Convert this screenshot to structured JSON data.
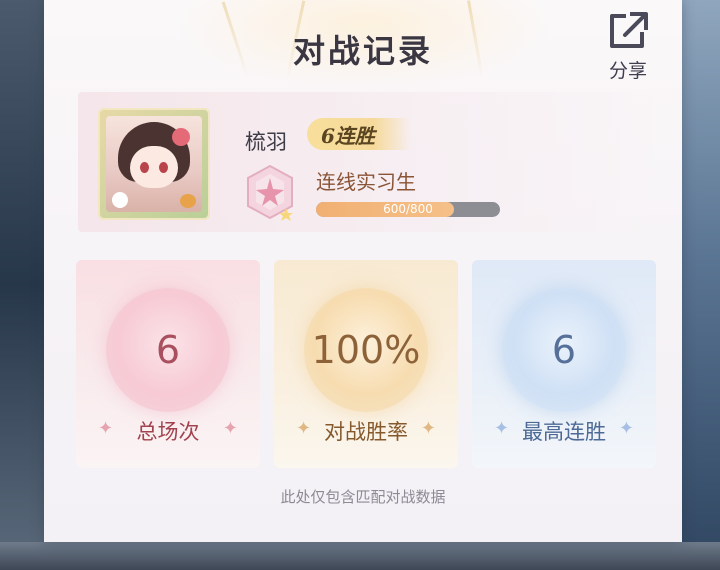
{
  "header": {
    "title": "对战记录",
    "share_label": "分享",
    "share_icon": "share-icon"
  },
  "profile": {
    "username": "梳羽",
    "streak_badge": "6连胜",
    "rank_name": "连线实习生",
    "xp_text": "600/800",
    "xp_current": 600,
    "xp_max": 800,
    "rank_icon": "pink-star-emblem-icon"
  },
  "stats": [
    {
      "value": "6",
      "label": "总场次",
      "theme": "pink"
    },
    {
      "value": "100%",
      "label": "对战胜率",
      "theme": "gold"
    },
    {
      "value": "6",
      "label": "最高连胜",
      "theme": "blue"
    }
  ],
  "footnote": "此处仅包含匹配对战数据",
  "colors": {
    "pink_accent": "#a8505f",
    "gold_accent": "#8d6238",
    "blue_accent": "#56709a",
    "xp_fill": "#f1b072"
  }
}
